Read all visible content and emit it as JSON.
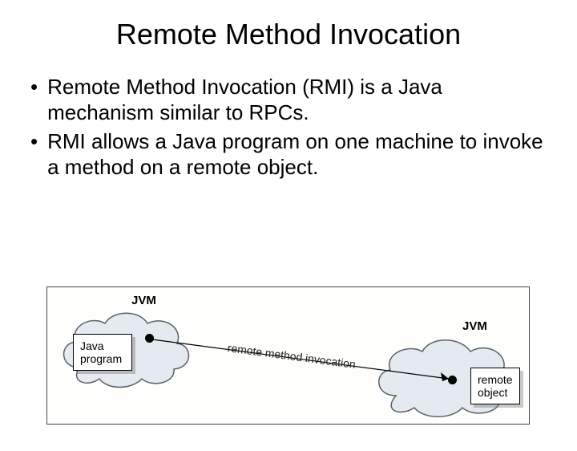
{
  "title": "Remote Method Invocation",
  "bullets": [
    "Remote Method Invocation (RMI) is a Java mechanism similar to RPCs.",
    "RMI allows a Java program on one machine to invoke a method on a remote object."
  ],
  "diagram": {
    "jvm_label_left": "JVM",
    "jvm_label_right": "JVM",
    "java_program_label": "Java\nprogram",
    "remote_object_label": "remote\nobject",
    "arrow_label": "remote method invocation"
  }
}
